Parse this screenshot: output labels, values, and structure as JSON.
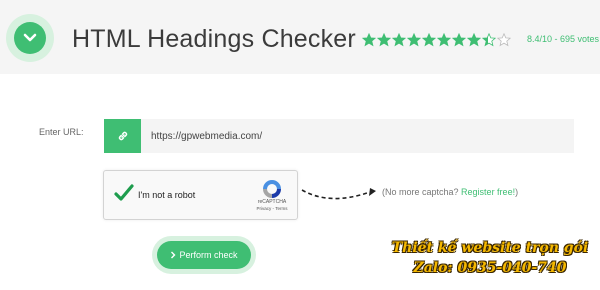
{
  "header": {
    "title": "HTML Headings Checker",
    "rating_text": "8.4/10 - 695 votes",
    "stars": {
      "value": 8.4,
      "max": 10
    },
    "icon": "chevron-down-icon"
  },
  "form": {
    "url_label": "Enter URL:",
    "url_value": "https://gpwebmedia.com/",
    "link_icon": "link-icon"
  },
  "captcha": {
    "label": "I'm not a robot",
    "brand": "reCAPTCHA",
    "links": "Privacy - Terms"
  },
  "no_captcha": {
    "prefix": "(No more captcha? ",
    "link": "Register free!",
    "suffix": ")"
  },
  "action": {
    "button_label": "Perform check",
    "button_icon": "chevron-right-icon"
  },
  "watermark": {
    "line1": "Thiết kế website trọn gói",
    "line2": "Zalo: 0935-040-740"
  },
  "colors": {
    "accent": "#3fbe73",
    "accent_light": "#d7f1df",
    "watermark": "#f5b800"
  }
}
